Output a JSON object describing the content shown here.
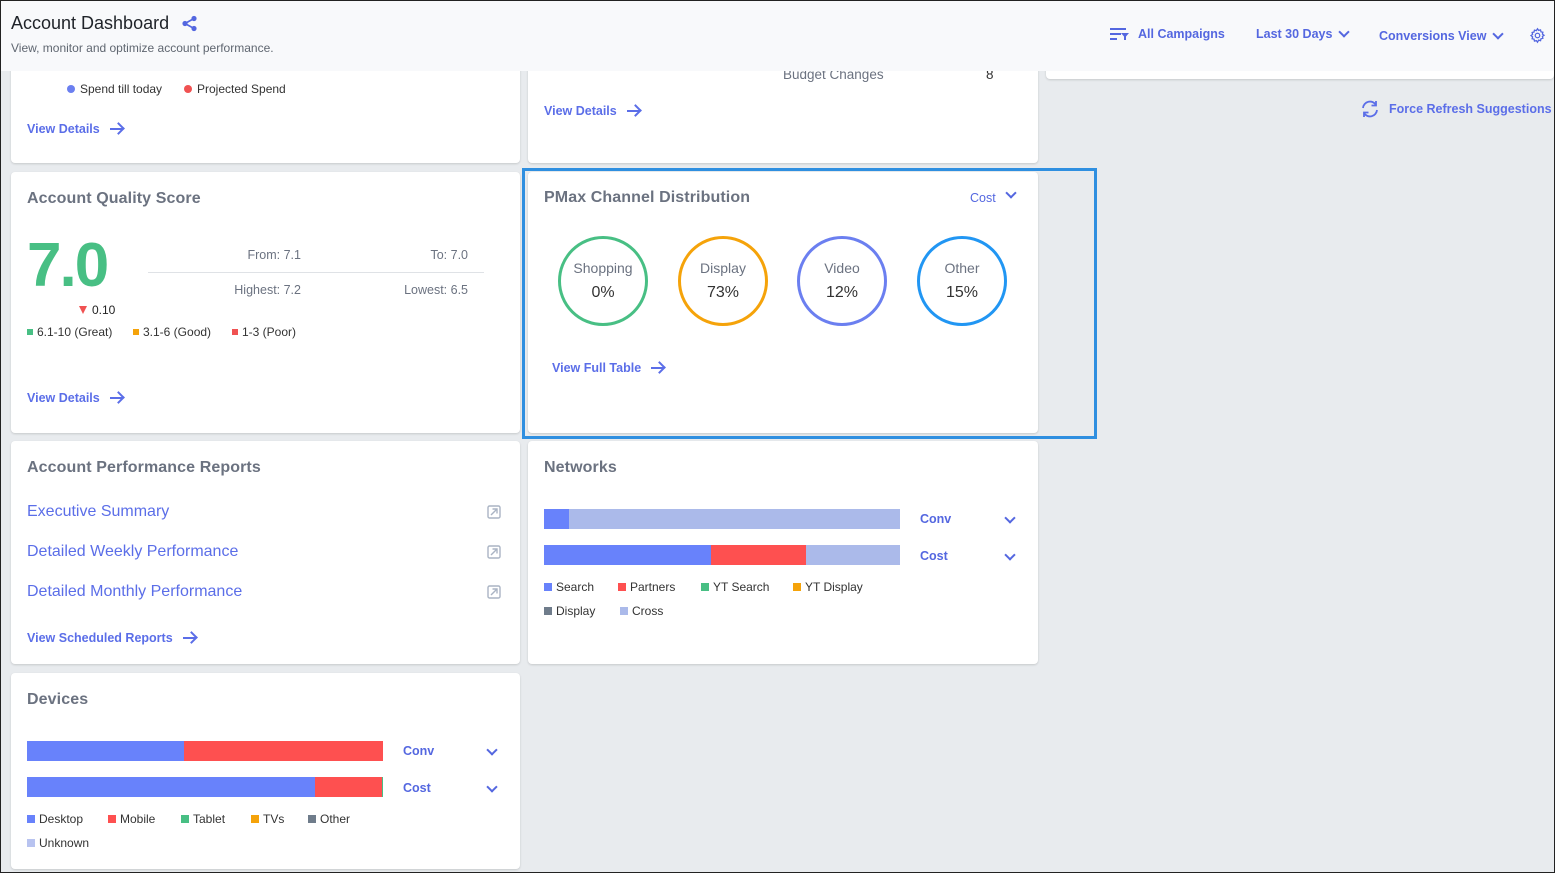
{
  "header": {
    "title": "Account Dashboard",
    "subtitle": "View, monitor and optimize account performance.",
    "campaign_filter": "All Campaigns",
    "date_range": "Last 30 Days",
    "view_mode": "Conversions View",
    "force_refresh": "Force Refresh Suggestions"
  },
  "spend_card": {
    "legend": [
      "Spend till today",
      "Projected Spend"
    ],
    "colors": [
      "#6b7ff0",
      "#f05252"
    ],
    "view_details": "View Details"
  },
  "changes_card": {
    "row_label": "Budget Changes",
    "row_value": "8",
    "view_details": "View Details"
  },
  "quality_score": {
    "title": "Account Quality Score",
    "score": "7.0",
    "delta": "0.10",
    "delta_direction": "down",
    "from": "From: 7.1",
    "to": "To: 7.0",
    "highest": "Highest: 7.2",
    "lowest": "Lowest: 6.5",
    "legend": [
      {
        "label": "6.1-10 (Great)",
        "color": "#48bf84"
      },
      {
        "label": "3.1-6 (Good)",
        "color": "#f5a30a"
      },
      {
        "label": "1-3 (Poor)",
        "color": "#f05252"
      }
    ],
    "view_details": "View Details"
  },
  "pmax": {
    "title": "PMax Channel Distribution",
    "metric": "Cost",
    "channels": [
      {
        "label": "Shopping",
        "value": "0%",
        "color": "#48bf84"
      },
      {
        "label": "Display",
        "value": "73%",
        "color": "#f5a30a"
      },
      {
        "label": "Video",
        "value": "12%",
        "color": "#6b7ff0"
      },
      {
        "label": "Other",
        "value": "15%",
        "color": "#2196f3"
      }
    ],
    "view_full_table": "View Full Table"
  },
  "reports": {
    "title": "Account Performance Reports",
    "items": [
      "Executive Summary",
      "Detailed Weekly Performance",
      "Detailed Monthly Performance"
    ],
    "view_scheduled": "View Scheduled Reports"
  },
  "networks": {
    "title": "Networks",
    "bars": [
      {
        "metric": "Conv",
        "segments": [
          {
            "name": "Search",
            "pct": 7
          },
          {
            "name": "Cross",
            "pct": 93
          }
        ]
      },
      {
        "metric": "Cost",
        "segments": [
          {
            "name": "Search",
            "pct": 47
          },
          {
            "name": "Partners",
            "pct": 26.7
          },
          {
            "name": "Cross",
            "pct": 26.3
          }
        ]
      }
    ],
    "legend": [
      {
        "label": "Search",
        "color": "#6882fb"
      },
      {
        "label": "Partners",
        "color": "#fe5050"
      },
      {
        "label": "YT Search",
        "color": "#48bf84"
      },
      {
        "label": "YT Display",
        "color": "#f5a30a"
      },
      {
        "label": "Display",
        "color": "#6f7c8b"
      },
      {
        "label": "Cross",
        "color": "#abbaea"
      }
    ]
  },
  "devices": {
    "title": "Devices",
    "bars": [
      {
        "metric": "Conv",
        "segments": [
          {
            "name": "Desktop",
            "pct": 44
          },
          {
            "name": "Mobile",
            "pct": 56
          }
        ]
      },
      {
        "metric": "Cost",
        "segments": [
          {
            "name": "Desktop",
            "pct": 81
          },
          {
            "name": "Mobile",
            "pct": 18.7
          },
          {
            "name": "Tablet",
            "pct": 0.3
          }
        ]
      }
    ],
    "legend": [
      {
        "label": "Desktop",
        "color": "#6882fb"
      },
      {
        "label": "Mobile",
        "color": "#fe5050"
      },
      {
        "label": "Tablet",
        "color": "#48bf84"
      },
      {
        "label": "TVs",
        "color": "#f5a30a"
      },
      {
        "label": "Other",
        "color": "#6f7c8b"
      },
      {
        "label": "Unknown",
        "color": "#b8c3f0"
      }
    ]
  }
}
